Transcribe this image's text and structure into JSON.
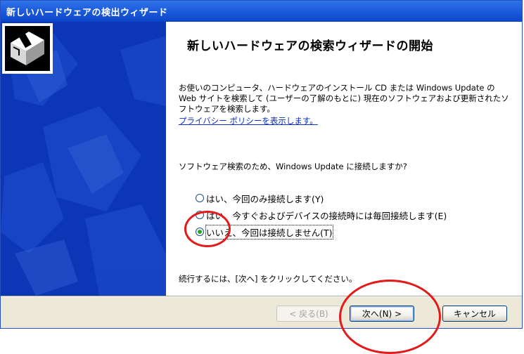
{
  "window": {
    "title": "新しいハードウェアの検出ウィザード"
  },
  "wizard": {
    "heading": "新しいハードウェアの検索ウィザードの開始",
    "description": "お使いのコンピュータ、ハードウェアのインストール CD または Windows Update の Web サイトを検索して (ユーザーの了解のもとに) 現在のソフトウェアおよび更新されたソフトウェアを検索します。",
    "privacy_link": "プライバシー ポリシーを表示します。",
    "question": "ソフトウェア検索のため、Windows Update に接続しますか?",
    "options": [
      {
        "label": "はい、今回のみ接続します(Y)",
        "checked": false
      },
      {
        "label": "はい、今すぐおよびデバイスの接続時には毎回接続します(E)",
        "checked": false
      },
      {
        "label": "いいえ、今回は接続しません(T)",
        "checked": true
      }
    ],
    "instruction": "続行するには、[次へ] をクリックしてください。"
  },
  "buttons": {
    "back": "< 戻る(B)",
    "next": "次へ(N) >",
    "cancel": "キャンセル"
  },
  "colors": {
    "title_bar": "#0c46c8",
    "side_panel": "#0b37b6",
    "annotation": "#e31a1a",
    "radio_selected": "#27a727"
  }
}
